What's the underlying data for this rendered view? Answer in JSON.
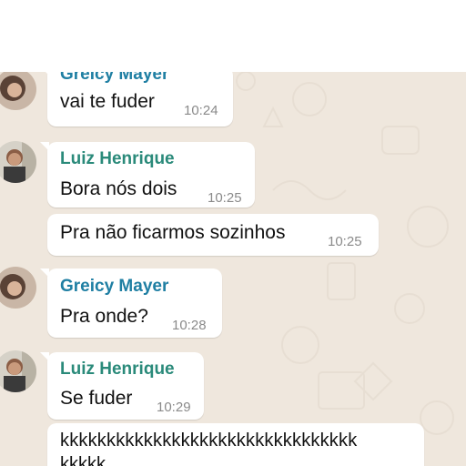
{
  "messages": [
    {
      "sender": "Greicy Mayer",
      "text": "vai te fuder",
      "time": "10:24"
    },
    {
      "sender": "Luiz Henrique",
      "text": "Bora nós dois",
      "time": "10:25"
    },
    {
      "sender": "",
      "text": "Pra não ficarmos sozinhos",
      "time": "10:25"
    },
    {
      "sender": "Greicy Mayer",
      "text": "Pra onde?",
      "time": "10:28"
    },
    {
      "sender": "Luiz Henrique",
      "text": "Se fuder",
      "time": "10:29"
    },
    {
      "sender": "",
      "text": "kkkkkkkkkkkkkkkkkkkkkkkkkkkkkkkk",
      "text2": "kkkkk",
      "time": ""
    }
  ],
  "colors": {
    "chat_background": "#efe7dd",
    "bubble": "#ffffff",
    "greicy_name": "#1f7fa3",
    "luiz_name": "#2a8a7a"
  }
}
